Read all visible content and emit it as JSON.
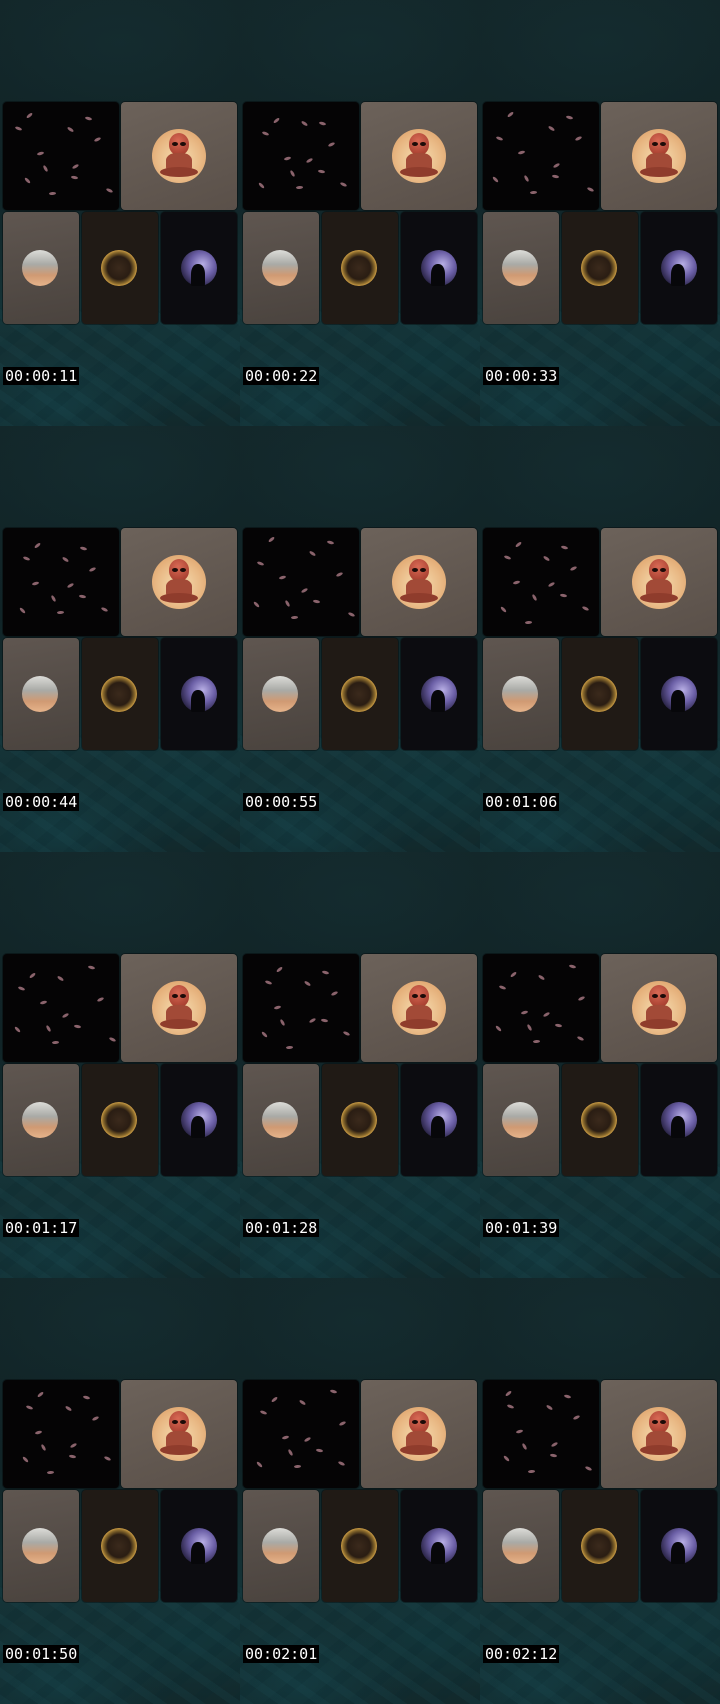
{
  "timestamps": [
    "00:00:11",
    "00:00:22",
    "00:00:33",
    "00:00:44",
    "00:00:55",
    "00:01:06",
    "00:01:17",
    "00:01:28",
    "00:01:39",
    "00:01:50",
    "00:02:01",
    "00:02:12"
  ],
  "tiles": [
    "petals",
    "alien-meditating",
    "moon",
    "portrait",
    "night-silhouette"
  ]
}
